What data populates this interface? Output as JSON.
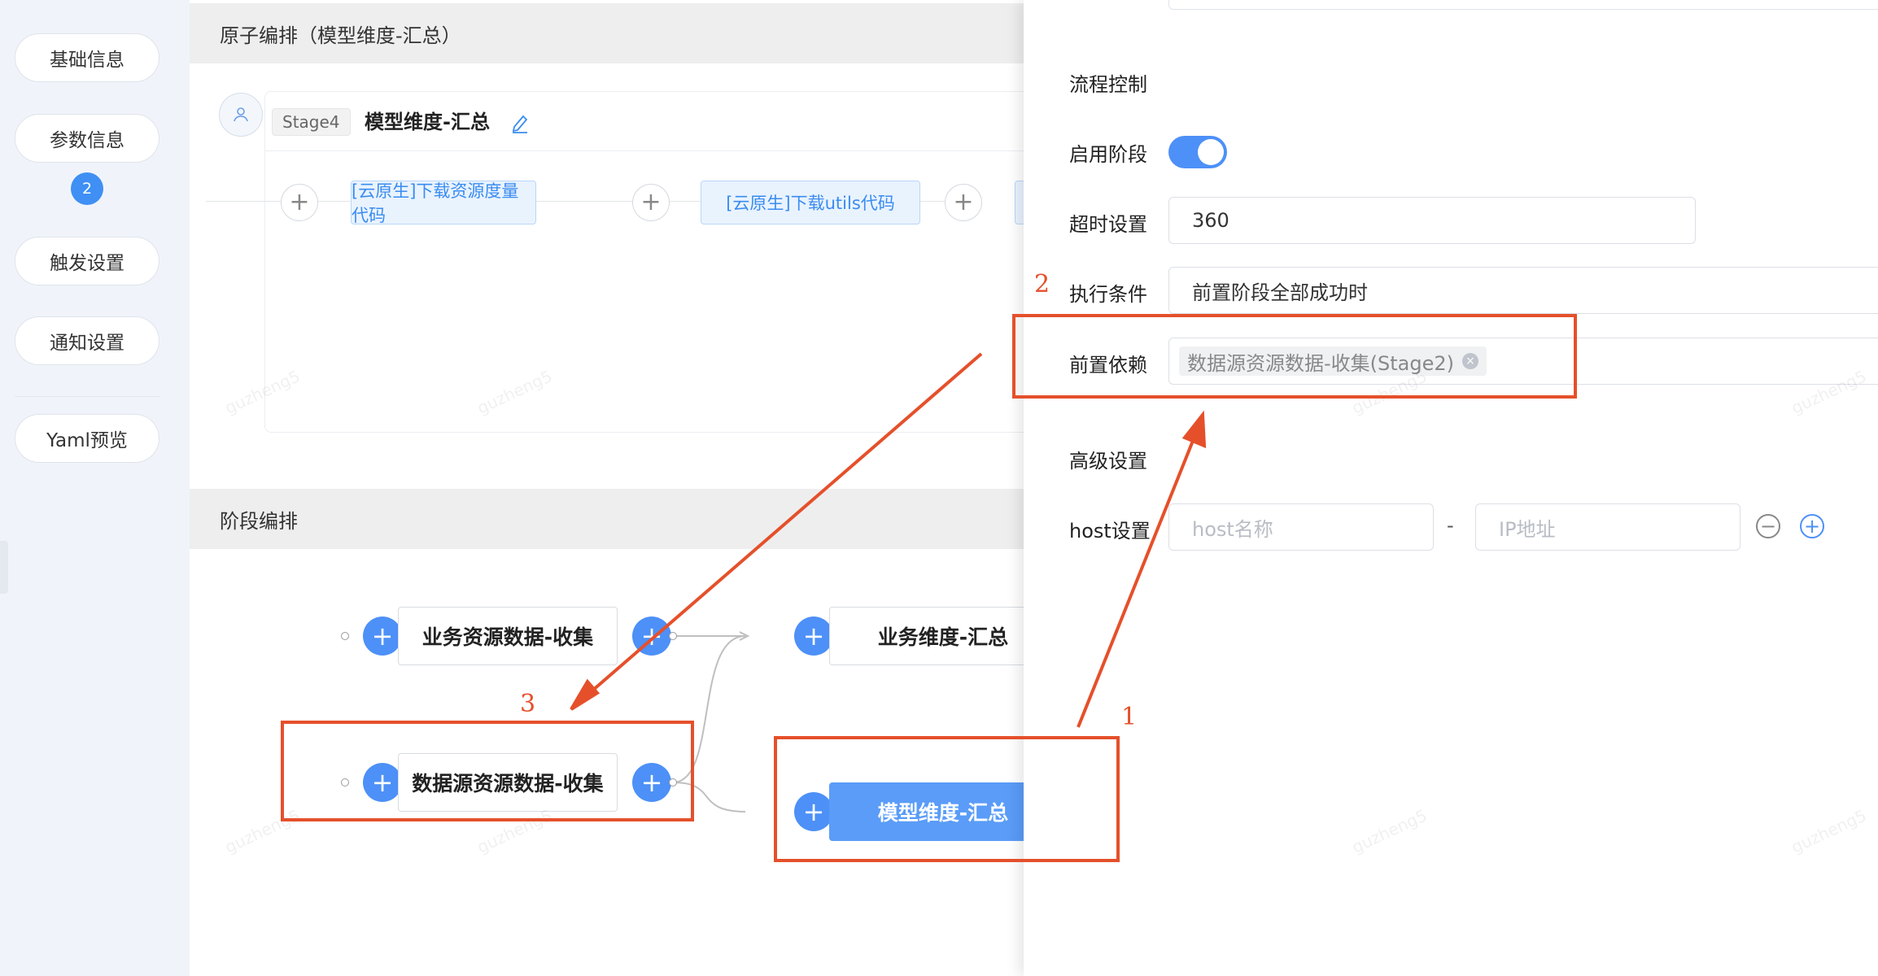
{
  "sidebar": {
    "items": [
      {
        "label": "基础信息"
      },
      {
        "label": "参数信息"
      },
      {
        "label": "触发设置"
      },
      {
        "label": "通知设置"
      },
      {
        "label": "Yaml预览"
      }
    ],
    "badge": "2"
  },
  "atom_section": {
    "title": "原子编排（模型维度-汇总）",
    "stage_tag": "Stage4",
    "stage_name": "模型维度-汇总",
    "atoms": [
      "[云原生]下载资源度量代码",
      "[云原生]下载utils代码"
    ]
  },
  "stage_section": {
    "title": "阶段编排",
    "nodes": [
      "业务资源数据-收集",
      "业务维度-汇总",
      "数据源资源数据-收集",
      "模型维度-汇总"
    ]
  },
  "panel": {
    "flow_control_heading": "流程控制",
    "enable_label": "启用阶段",
    "enable_on": true,
    "timeout_label": "超时设置",
    "timeout_value": "360",
    "condition_label": "执行条件",
    "condition_value": "前置阶段全部成功时",
    "dependency_label": "前置依赖",
    "dependency_tag": "数据源资源数据-收集(Stage2)",
    "advanced_heading": "高级设置",
    "host_label": "host设置",
    "host_name_placeholder": "host名称",
    "host_separator": "-",
    "host_ip_placeholder": "IP地址"
  },
  "annotations": {
    "one": "1",
    "two": "2",
    "three": "3",
    "color": "#e5502b"
  },
  "watermark": "guzheng5",
  "colors": {
    "primary": "#4d90f7",
    "sidebar_bg": "#f0f4fa"
  }
}
